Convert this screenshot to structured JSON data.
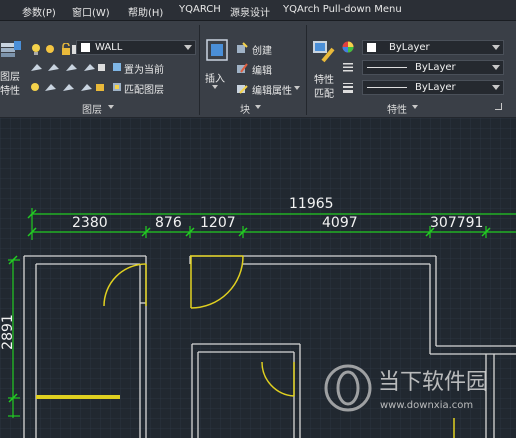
{
  "menubar": {
    "items": [
      "参数(P)",
      "窗口(W)",
      "帮助(H)",
      "YQARCH",
      "源泉设计",
      "YQArch Pull-down Menu"
    ]
  },
  "ribbon": {
    "layers_panel": {
      "label": "图层",
      "large_button_line1": "图层",
      "large_button_line2": "特性",
      "layer_dropdown_value": "WALL",
      "set_current_label": "置为当前",
      "match_layer_label": "匹配图层"
    },
    "block_panel": {
      "label": "块",
      "insert_label": "插入",
      "create_label": "创建",
      "edit_label": "编辑",
      "edit_attributes_label": "编辑属性"
    },
    "properties_panel": {
      "label": "特性",
      "match_label_line1": "特性",
      "match_label_line2": "匹配",
      "color_value": "ByLayer",
      "linetype_value": "ByLayer",
      "lineweight_value": "ByLayer"
    }
  },
  "drawing": {
    "overall_dimension": "11965",
    "segment_dimensions": [
      "2380",
      "876",
      "1207",
      "4097",
      "307791"
    ],
    "vertical_dimension": "2891",
    "colors": {
      "background": "#212830",
      "dimension_line": "#22cc22",
      "wall": "#d8d8d8",
      "door": "#e0d020"
    }
  },
  "watermark": {
    "title": "当下软件园",
    "url": "www.downxia.com"
  }
}
